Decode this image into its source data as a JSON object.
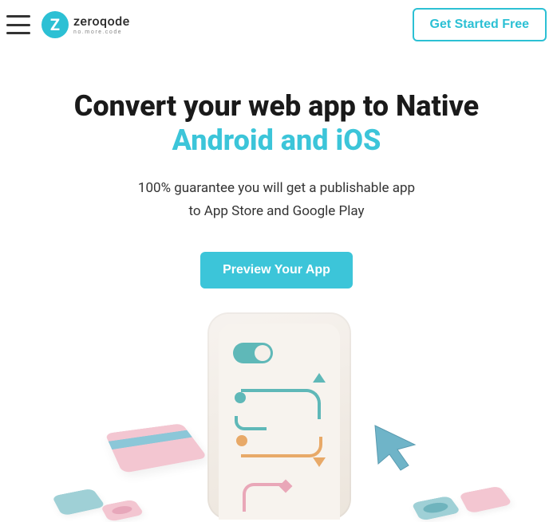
{
  "header": {
    "brand_name": "zeroqode",
    "brand_tagline": "no.more.code",
    "cta_label": "Get Started Free"
  },
  "hero": {
    "title_line1": "Convert your web app to Native",
    "title_line2": "Android and iOS",
    "subtitle_line1": "100% guarantee you will get a publishable app",
    "subtitle_line2": "to App Store and Google Play",
    "preview_label": "Preview Your App"
  },
  "colors": {
    "accent": "#3cc5d9",
    "text": "#1a1a1a"
  }
}
